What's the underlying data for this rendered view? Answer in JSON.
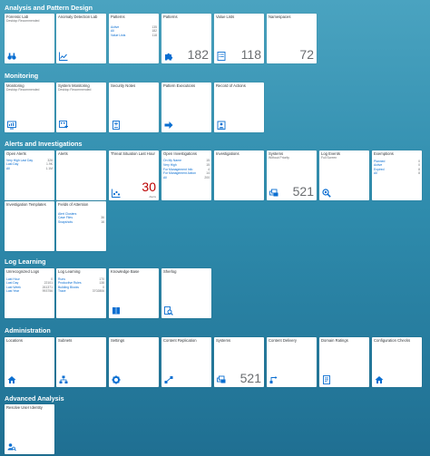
{
  "sections": {
    "analysis": "Analysis and Pattern Design",
    "monitoring": "Monitoring",
    "alerts": "Alerts and Investigations",
    "log_learning": "Log Learning",
    "administration": "Administration",
    "advanced": "Advanced Analysis"
  },
  "analysis": {
    "forensic": {
      "title": "Forensic Lab",
      "sub": "Desktop Recommended"
    },
    "anomaly": {
      "title": "Anomaly Detection Lab"
    },
    "patterns": {
      "title": "Patterns",
      "rows": [
        {
          "label": "Active",
          "value": "135"
        },
        {
          "label": "All",
          "value": "182"
        },
        {
          "label": "Value Lists",
          "value": "118"
        }
      ]
    },
    "patterns2": {
      "title": "Patterns",
      "kpi": "182"
    },
    "valuelists": {
      "title": "Value Lists",
      "kpi": "118"
    },
    "namespaces": {
      "title": "Namespaces",
      "kpi": "72"
    }
  },
  "monitoring": {
    "monitoring": {
      "title": "Monitoring",
      "sub": "Desktop Recommended"
    },
    "system": {
      "title": "System Monitoring",
      "sub": "Desktop Recommended"
    },
    "security_notes": {
      "title": "Security Notes"
    },
    "pattern_exec": {
      "title": "Pattern Executions"
    },
    "record": {
      "title": "Record of Actions"
    }
  },
  "alerts": {
    "open_alerts": {
      "title": "Open Alerts",
      "rows": [
        {
          "label": "Very High Last Day",
          "value": "326"
        },
        {
          "label": "Last Day",
          "value": "1.9K"
        },
        {
          "label": "All",
          "value": "1.1M"
        }
      ]
    },
    "alerts": {
      "title": "Alerts"
    },
    "threat": {
      "title": "Threat Situation Last Hour",
      "kpi": "30",
      "unit": "Alerts"
    },
    "open_inv": {
      "title": "Open Investigations",
      "rows": [
        {
          "label": "On My Name",
          "value": "15"
        },
        {
          "label": "Very High",
          "value": "15"
        },
        {
          "label": "For Management Info",
          "value": "4"
        },
        {
          "label": "For Management Action",
          "value": "14"
        },
        {
          "label": "All",
          "value": "200"
        }
      ]
    },
    "investigations": {
      "title": "Investigations"
    },
    "systems": {
      "title": "Systems",
      "sub": "Without Priority",
      "kpi": "521"
    },
    "log_events": {
      "title": "Log Events",
      "sub": "Full Screen"
    },
    "exemptions": {
      "title": "Exemptions",
      "rows": [
        {
          "label": "Planned",
          "value": "0"
        },
        {
          "label": "Active",
          "value": "0"
        },
        {
          "label": "Expired",
          "value": "8"
        },
        {
          "label": "All",
          "value": "8"
        }
      ]
    },
    "inv_templates": {
      "title": "Investigation Templates"
    },
    "fields": {
      "title": "Fields of Attention",
      "rows": [
        {
          "label": "Alert Clusters",
          "value": ""
        },
        {
          "label": "Case Files",
          "value": "36"
        },
        {
          "label": "Snapshots",
          "value": "16"
        }
      ]
    }
  },
  "log_learning": {
    "unrecognized": {
      "title": "Unrecognized Logs",
      "rows": [
        {
          "label": "Last Hour",
          "value": "0"
        },
        {
          "label": "Last Day",
          "value": "22101"
        },
        {
          "label": "Last Week",
          "value": "261371"
        },
        {
          "label": "Last Year",
          "value": "993756"
        }
      ]
    },
    "log_learning": {
      "title": "Log Learning",
      "rows": [
        {
          "label": "Runs",
          "value": "170"
        },
        {
          "label": "Productive Rules",
          "value": "138"
        },
        {
          "label": "Building Blocks",
          "value": "0"
        },
        {
          "label": "Trace",
          "value": "3702806"
        }
      ]
    },
    "knowledge": {
      "title": "Knowledge Base"
    },
    "sherlog": {
      "title": "Sherlog"
    }
  },
  "administration": {
    "locations": {
      "title": "Locations"
    },
    "subnets": {
      "title": "Subnets"
    },
    "settings": {
      "title": "Settings"
    },
    "content_rep": {
      "title": "Content Replication"
    },
    "systems": {
      "title": "Systems",
      "kpi": "521"
    },
    "content_del": {
      "title": "Content Delivery"
    },
    "domain": {
      "title": "Domain Ratings"
    },
    "config": {
      "title": "Configuration Checks"
    }
  },
  "advanced": {
    "resolve": {
      "title": "Resolve User Identity"
    }
  },
  "colors": {
    "accent": "#0a6ed1",
    "alert": "#bb0000"
  }
}
